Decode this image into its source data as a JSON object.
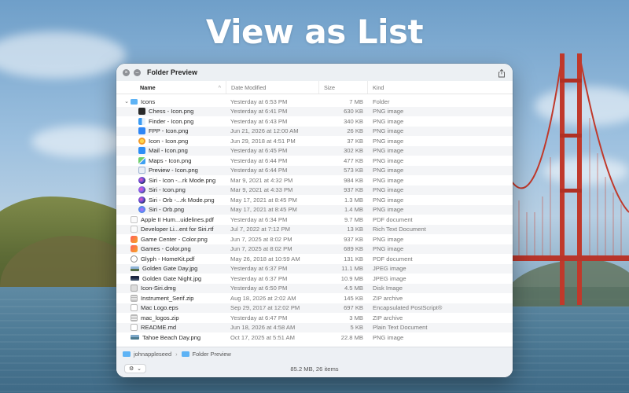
{
  "headline": "View as List",
  "window": {
    "title": "Folder Preview",
    "controls": {
      "close_glyph": "×",
      "minimize_glyph": "–"
    },
    "share_icon": "share-icon"
  },
  "columns": {
    "name": "Name",
    "date": "Date Modified",
    "size": "Size",
    "kind": "Kind",
    "sort_glyph": "^"
  },
  "rows": [
    {
      "icon": "ic-folder",
      "level": 0,
      "disclosure": "⌄",
      "name": "Icons",
      "date": "Yesterday at 6:53 PM",
      "size": "7 MB",
      "kind": "Folder"
    },
    {
      "icon": "ic-chess",
      "level": 1,
      "name": "Chess - Icon.png",
      "date": "Yesterday at 6:41 PM",
      "size": "630 KB",
      "kind": "PNG image"
    },
    {
      "icon": "ic-finder",
      "level": 1,
      "name": "Finder - Icon.png",
      "date": "Yesterday at 6:43 PM",
      "size": "340 KB",
      "kind": "PNG image"
    },
    {
      "icon": "ic-fpp",
      "level": 1,
      "name": "FPP - Icon.png",
      "date": "Jun 21, 2026 at 12:00 AM",
      "size": "26 KB",
      "kind": "PNG image"
    },
    {
      "icon": "ic-icon",
      "level": 1,
      "name": "Icon - Icon.png",
      "date": "Jun 29, 2018 at 4:51 PM",
      "size": "37 KB",
      "kind": "PNG image"
    },
    {
      "icon": "ic-mail",
      "level": 1,
      "name": "Mail - Icon.png",
      "date": "Yesterday at 6:45 PM",
      "size": "302 KB",
      "kind": "PNG image"
    },
    {
      "icon": "ic-maps",
      "level": 1,
      "name": "Maps - Icon.png",
      "date": "Yesterday at 6:44 PM",
      "size": "477 KB",
      "kind": "PNG image"
    },
    {
      "icon": "ic-preview",
      "level": 1,
      "name": "Preview - Icon.png",
      "date": "Yesterday at 6:44 PM",
      "size": "573 KB",
      "kind": "PNG image"
    },
    {
      "icon": "ic-siri-dark",
      "level": 1,
      "name": "Siri - Icon -...rk Mode.png",
      "date": "Mar 9, 2021 at 4:32 PM",
      "size": "984 KB",
      "kind": "PNG image"
    },
    {
      "icon": "ic-siri",
      "level": 1,
      "name": "Siri - Icon.png",
      "date": "Mar 9, 2021 at 4:33 PM",
      "size": "937 KB",
      "kind": "PNG image"
    },
    {
      "icon": "ic-siri-dark",
      "level": 1,
      "name": "Siri - Orb -...rk Mode.png",
      "date": "May 17, 2021 at 8:45 PM",
      "size": "1.3 MB",
      "kind": "PNG image"
    },
    {
      "icon": "ic-orb",
      "level": 1,
      "name": "Siri - Orb.png",
      "date": "May 17, 2021 at 8:45 PM",
      "size": "1.4 MB",
      "kind": "PNG image"
    },
    {
      "icon": "ic-doc",
      "level": 0,
      "name": "Apple II Hum...uidelines.pdf",
      "date": "Yesterday at 6:34 PM",
      "size": "9.7 MB",
      "kind": "PDF document"
    },
    {
      "icon": "ic-doc",
      "level": 0,
      "name": "Developer Li...ent for Siri.rtf",
      "date": "Jul 7, 2022 at 7:12 PM",
      "size": "13 KB",
      "kind": "Rich Text Document"
    },
    {
      "icon": "ic-game",
      "level": 0,
      "name": "Game Center - Color.png",
      "date": "Jun 7, 2025 at 8:02 PM",
      "size": "937 KB",
      "kind": "PNG image"
    },
    {
      "icon": "ic-game",
      "level": 0,
      "name": "Games - Color.png",
      "date": "Jun 7, 2025 at 8:02 PM",
      "size": "689 KB",
      "kind": "PNG image"
    },
    {
      "icon": "ic-glyph",
      "level": 0,
      "name": "Glyph - HomeKit.pdf",
      "date": "May 26, 2018 at 10:59 AM",
      "size": "131 KB",
      "kind": "PDF document"
    },
    {
      "icon": "ic-jpg-day",
      "level": 0,
      "name": "Golden Gate Day.jpg",
      "date": "Yesterday at 6:37 PM",
      "size": "11.1 MB",
      "kind": "JPEG image"
    },
    {
      "icon": "ic-jpg-night",
      "level": 0,
      "name": "Golden Gate Night.jpg",
      "date": "Yesterday at 6:37 PM",
      "size": "10.9 MB",
      "kind": "JPEG image"
    },
    {
      "icon": "ic-dmg",
      "level": 0,
      "name": "Icon-Siri.dmg",
      "date": "Yesterday at 6:50 PM",
      "size": "4.5 MB",
      "kind": "Disk Image"
    },
    {
      "icon": "ic-zip",
      "level": 0,
      "name": "Instrument_Serif.zip",
      "date": "Aug 18, 2026 at 2:02 AM",
      "size": "145 KB",
      "kind": "ZIP archive"
    },
    {
      "icon": "ic-eps",
      "level": 0,
      "name": "Mac Logo.eps",
      "date": "Sep 29, 2017 at 12:02 PM",
      "size": "697 KB",
      "kind": "Encapsulated PostScript®"
    },
    {
      "icon": "ic-zip",
      "level": 0,
      "name": "mac_logos.zip",
      "date": "Yesterday at 6:47 PM",
      "size": "3 MB",
      "kind": "ZIP archive"
    },
    {
      "icon": "ic-md",
      "level": 0,
      "name": "README.md",
      "date": "Jun 18, 2026 at 4:58 AM",
      "size": "5 KB",
      "kind": "Plain Text Document"
    },
    {
      "icon": "ic-jpg-tahoe",
      "level": 0,
      "name": "Tahoe Beach Day.png",
      "date": "Oct 17, 2025 at 5:51 AM",
      "size": "22.8 MB",
      "kind": "PNG image"
    }
  ],
  "path": {
    "user": "johnappleseed",
    "separator": "›",
    "folder": "Folder Preview"
  },
  "status": {
    "summary": "85.2 MB, 26 items",
    "action_glyph": "⚙",
    "chevron_glyph": "⌄"
  }
}
